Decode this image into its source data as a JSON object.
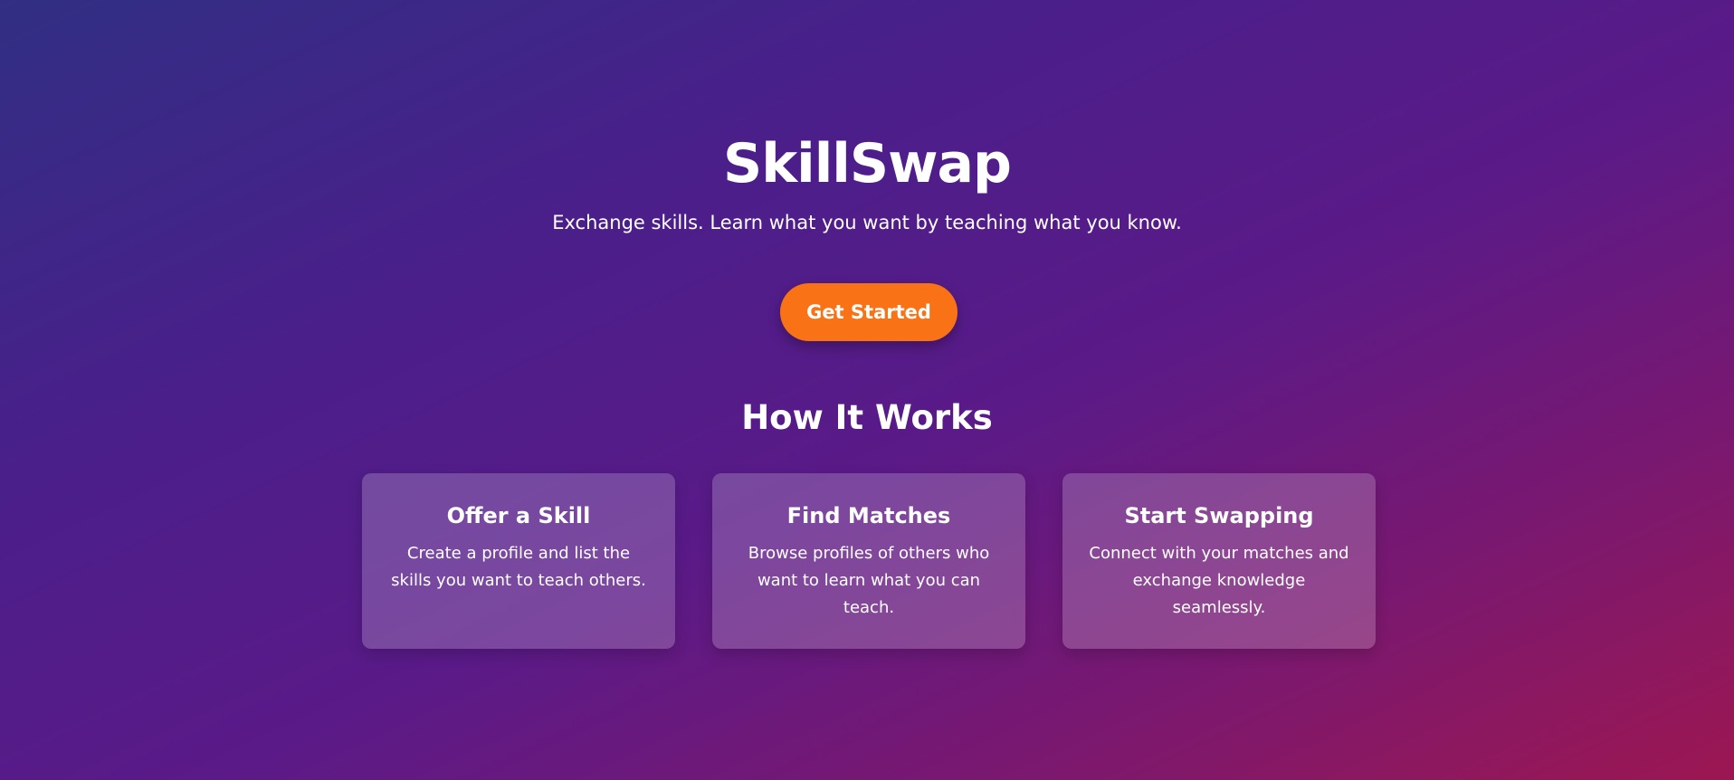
{
  "hero": {
    "title": "SkillSwap",
    "subtitle": "Exchange skills. Learn what you want by teaching what you know.",
    "cta_label": "Get Started"
  },
  "how_it_works": {
    "title": "How It Works",
    "cards": [
      {
        "title": "Offer a Skill",
        "text": "Create a profile and list the skills you want to teach others."
      },
      {
        "title": "Find Matches",
        "text": "Browse profiles of others who want to learn what you can teach."
      },
      {
        "title": "Start Swapping",
        "text": "Connect with your matches and exchange knowledge seamlessly."
      }
    ]
  },
  "colors": {
    "cta_background": "#f97316",
    "gradient_start": "#312f84",
    "gradient_end": "#9c1752"
  }
}
